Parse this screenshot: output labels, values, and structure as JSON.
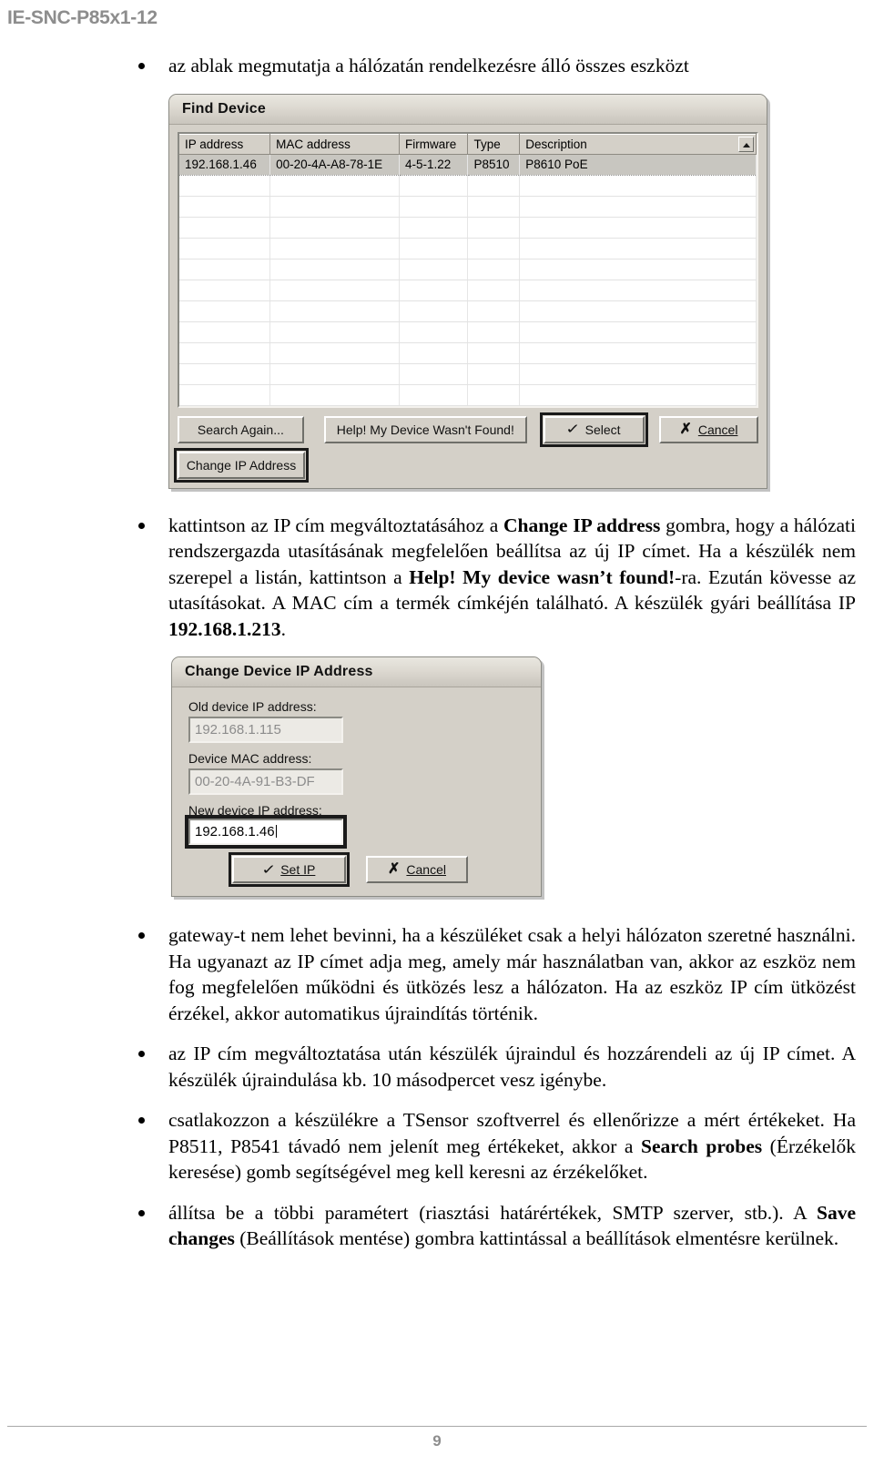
{
  "header": {
    "doc_code": "IE-SNC-P85x1-12"
  },
  "bullets": {
    "b1": "az ablak megmutatja a hálózatán rendelkezésre álló összes eszközt",
    "b2": {
      "p1": "kattintson az IP cím megváltoztatásához a ",
      "bold1": "Change IP address",
      "p2": " gombra, hogy a hálózati rendszergazda utasításának megfelelően beállítsa az új IP címet. Ha a készülék nem szerepel a listán, kattintson a ",
      "bold2": "Help! My device wasn’t found!",
      "p3": "-ra. Ezután kövesse az utasításokat. A MAC cím a termék címkéjén található. A készülék gyári beállítása IP ",
      "bold3": "192.168.1.213",
      "p4": "."
    },
    "b3": "gateway-t nem lehet bevinni, ha a készüléket csak a helyi hálózaton szeretné használni. Ha ugyanazt az IP címet adja meg, amely már használatban van, akkor az eszköz nem fog megfelelően működni és ütközés lesz a hálózaton. Ha az eszköz IP cím ütközést érzékel, akkor automatikus újraindítás történik.",
    "b4": "az IP cím megváltoztatása után készülék újraindul és hozzárendeli az új IP címet. A készülék újraindulása kb. 10 másodpercet vesz igénybe.",
    "b5": {
      "p1": "csatlakozzon a készülékre a TSensor szoftverrel és ellenőrizze a mért értékeket. Ha P8511, P8541 távadó nem jelenít meg értékeket, akkor a ",
      "bold1": "Search probes",
      "p2": " (Érzékelők keresése) gomb segítségével meg kell keresni az érzékelőket."
    },
    "b6": {
      "p1": "állítsa be a többi paramétert (riasztási határértékek, SMTP szerver, stb.). A ",
      "bold1": "Save changes",
      "p2": " (Beállítások mentése) gombra kattintással a beállítások elmentésre kerülnek."
    }
  },
  "find_device_dialog": {
    "title": "Find Device",
    "columns": [
      "IP address",
      "MAC address",
      "Firmware",
      "Type",
      "Description"
    ],
    "rows": [
      {
        "ip": "192.168.1.46",
        "mac": "00-20-4A-A8-78-1E",
        "firmware": "4-5-1.22",
        "type": "P8510",
        "description": "P8610 PoE"
      }
    ],
    "empty_row_count": 11,
    "scroll_up_icon": "scroll-up-arrow-icon",
    "buttons": {
      "search_again": "Search Again...",
      "help_not_found": "Help! My Device Wasn't Found!",
      "select": "Select",
      "cancel": "Cancel",
      "change_ip": "Change IP Address"
    },
    "icons": {
      "check": "✓",
      "cross": "✗"
    }
  },
  "change_ip_dialog": {
    "title": "Change Device IP Address",
    "fields": {
      "old_ip_label": "Old device IP address:",
      "old_ip_value": "192.168.1.115",
      "mac_label": "Device MAC address:",
      "mac_value": "00-20-4A-91-B3-DF",
      "new_ip_label": "New device IP address:",
      "new_ip_value": "192.168.1.46"
    },
    "buttons": {
      "set_ip": "Set IP",
      "cancel": "Cancel"
    },
    "icons": {
      "check": "✓",
      "cross": "✗"
    }
  },
  "footer": {
    "page_number": "9"
  }
}
